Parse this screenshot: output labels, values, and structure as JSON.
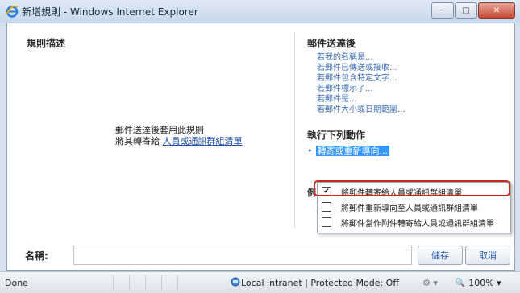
{
  "window": {
    "title": "新增規則 - Windows Internet Explorer",
    "controls": [
      "minimize",
      "maximize",
      "close"
    ]
  },
  "left_panel": {
    "heading": "規則描述",
    "description_line1": "郵件送達後套用此規則",
    "description_line2_prefix": "將其轉寄給",
    "description_line2_link": "人員或通訊群組清單"
  },
  "right_panel": {
    "conditions_heading": "郵件送達後",
    "conditions": [
      "若我的名稱是...",
      "若郵件已傳送或接收...",
      "若郵件包含特定文字...",
      "若郵件標示了...",
      "若郵件是...",
      "若郵件大小或日期範圍..."
    ],
    "actions_heading": "執行下列動作",
    "selected_action": "轉寄或重新導向...",
    "partial_label": "例",
    "dropdown_options": [
      {
        "label": "將郵件轉寄給人員或通訊群組清單",
        "checked": true
      },
      {
        "label": "將郵件重新導向至人員或通訊群組清單",
        "checked": false
      },
      {
        "label": "將郵件當作附件轉寄給人員或通訊群組清單",
        "checked": false
      }
    ]
  },
  "footer": {
    "name_label": "名稱:",
    "name_value": "",
    "save_label": "儲存",
    "cancel_label": "取消"
  },
  "statusbar": {
    "status": "Done",
    "zone": "Local intranet | Protected Mode: Off",
    "zoom": "100%"
  }
}
